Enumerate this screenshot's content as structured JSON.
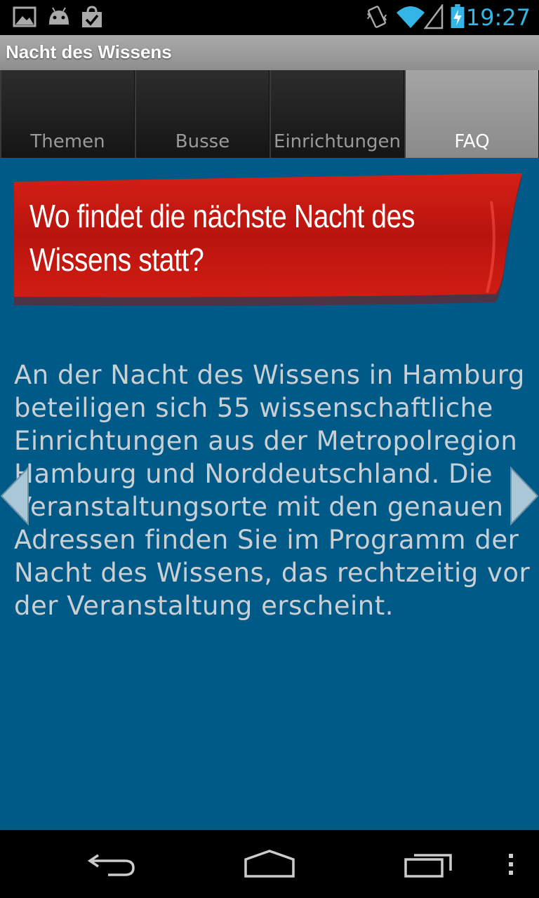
{
  "status_bar": {
    "time": "19:27",
    "icons": [
      "image-icon",
      "android-icon",
      "shopping-bag-icon",
      "vibrate-icon",
      "wifi-icon",
      "signal-icon",
      "battery-charging-icon"
    ],
    "accent_color": "#33b5e5"
  },
  "app": {
    "title": "Nacht des Wissens"
  },
  "tabs": [
    {
      "label": "Themen",
      "active": false
    },
    {
      "label": "Busse",
      "active": false
    },
    {
      "label": "Einrichtungen",
      "active": false
    },
    {
      "label": "FAQ",
      "active": true
    }
  ],
  "faq": {
    "question": "Wo findet die nächste Nacht des Wissens statt?",
    "answer": "An der Nacht des Wissens in Hamburg beteiligen sich 55 wissenschaftliche Einrichtungen aus der Metropolregion Hamburg und Norddeutschland. Die Veranstaltungsorte mit den genauen Adressen finden Sie im Programm der Nacht des Wissens, das rechtzeitig vor der Veranstaltung erscheint."
  },
  "colors": {
    "content_bg": "#005a87",
    "banner_red": "#cc1b14"
  },
  "nav_bar": {
    "buttons": [
      "back-icon",
      "home-icon",
      "recent-apps-icon",
      "menu-icon"
    ]
  }
}
